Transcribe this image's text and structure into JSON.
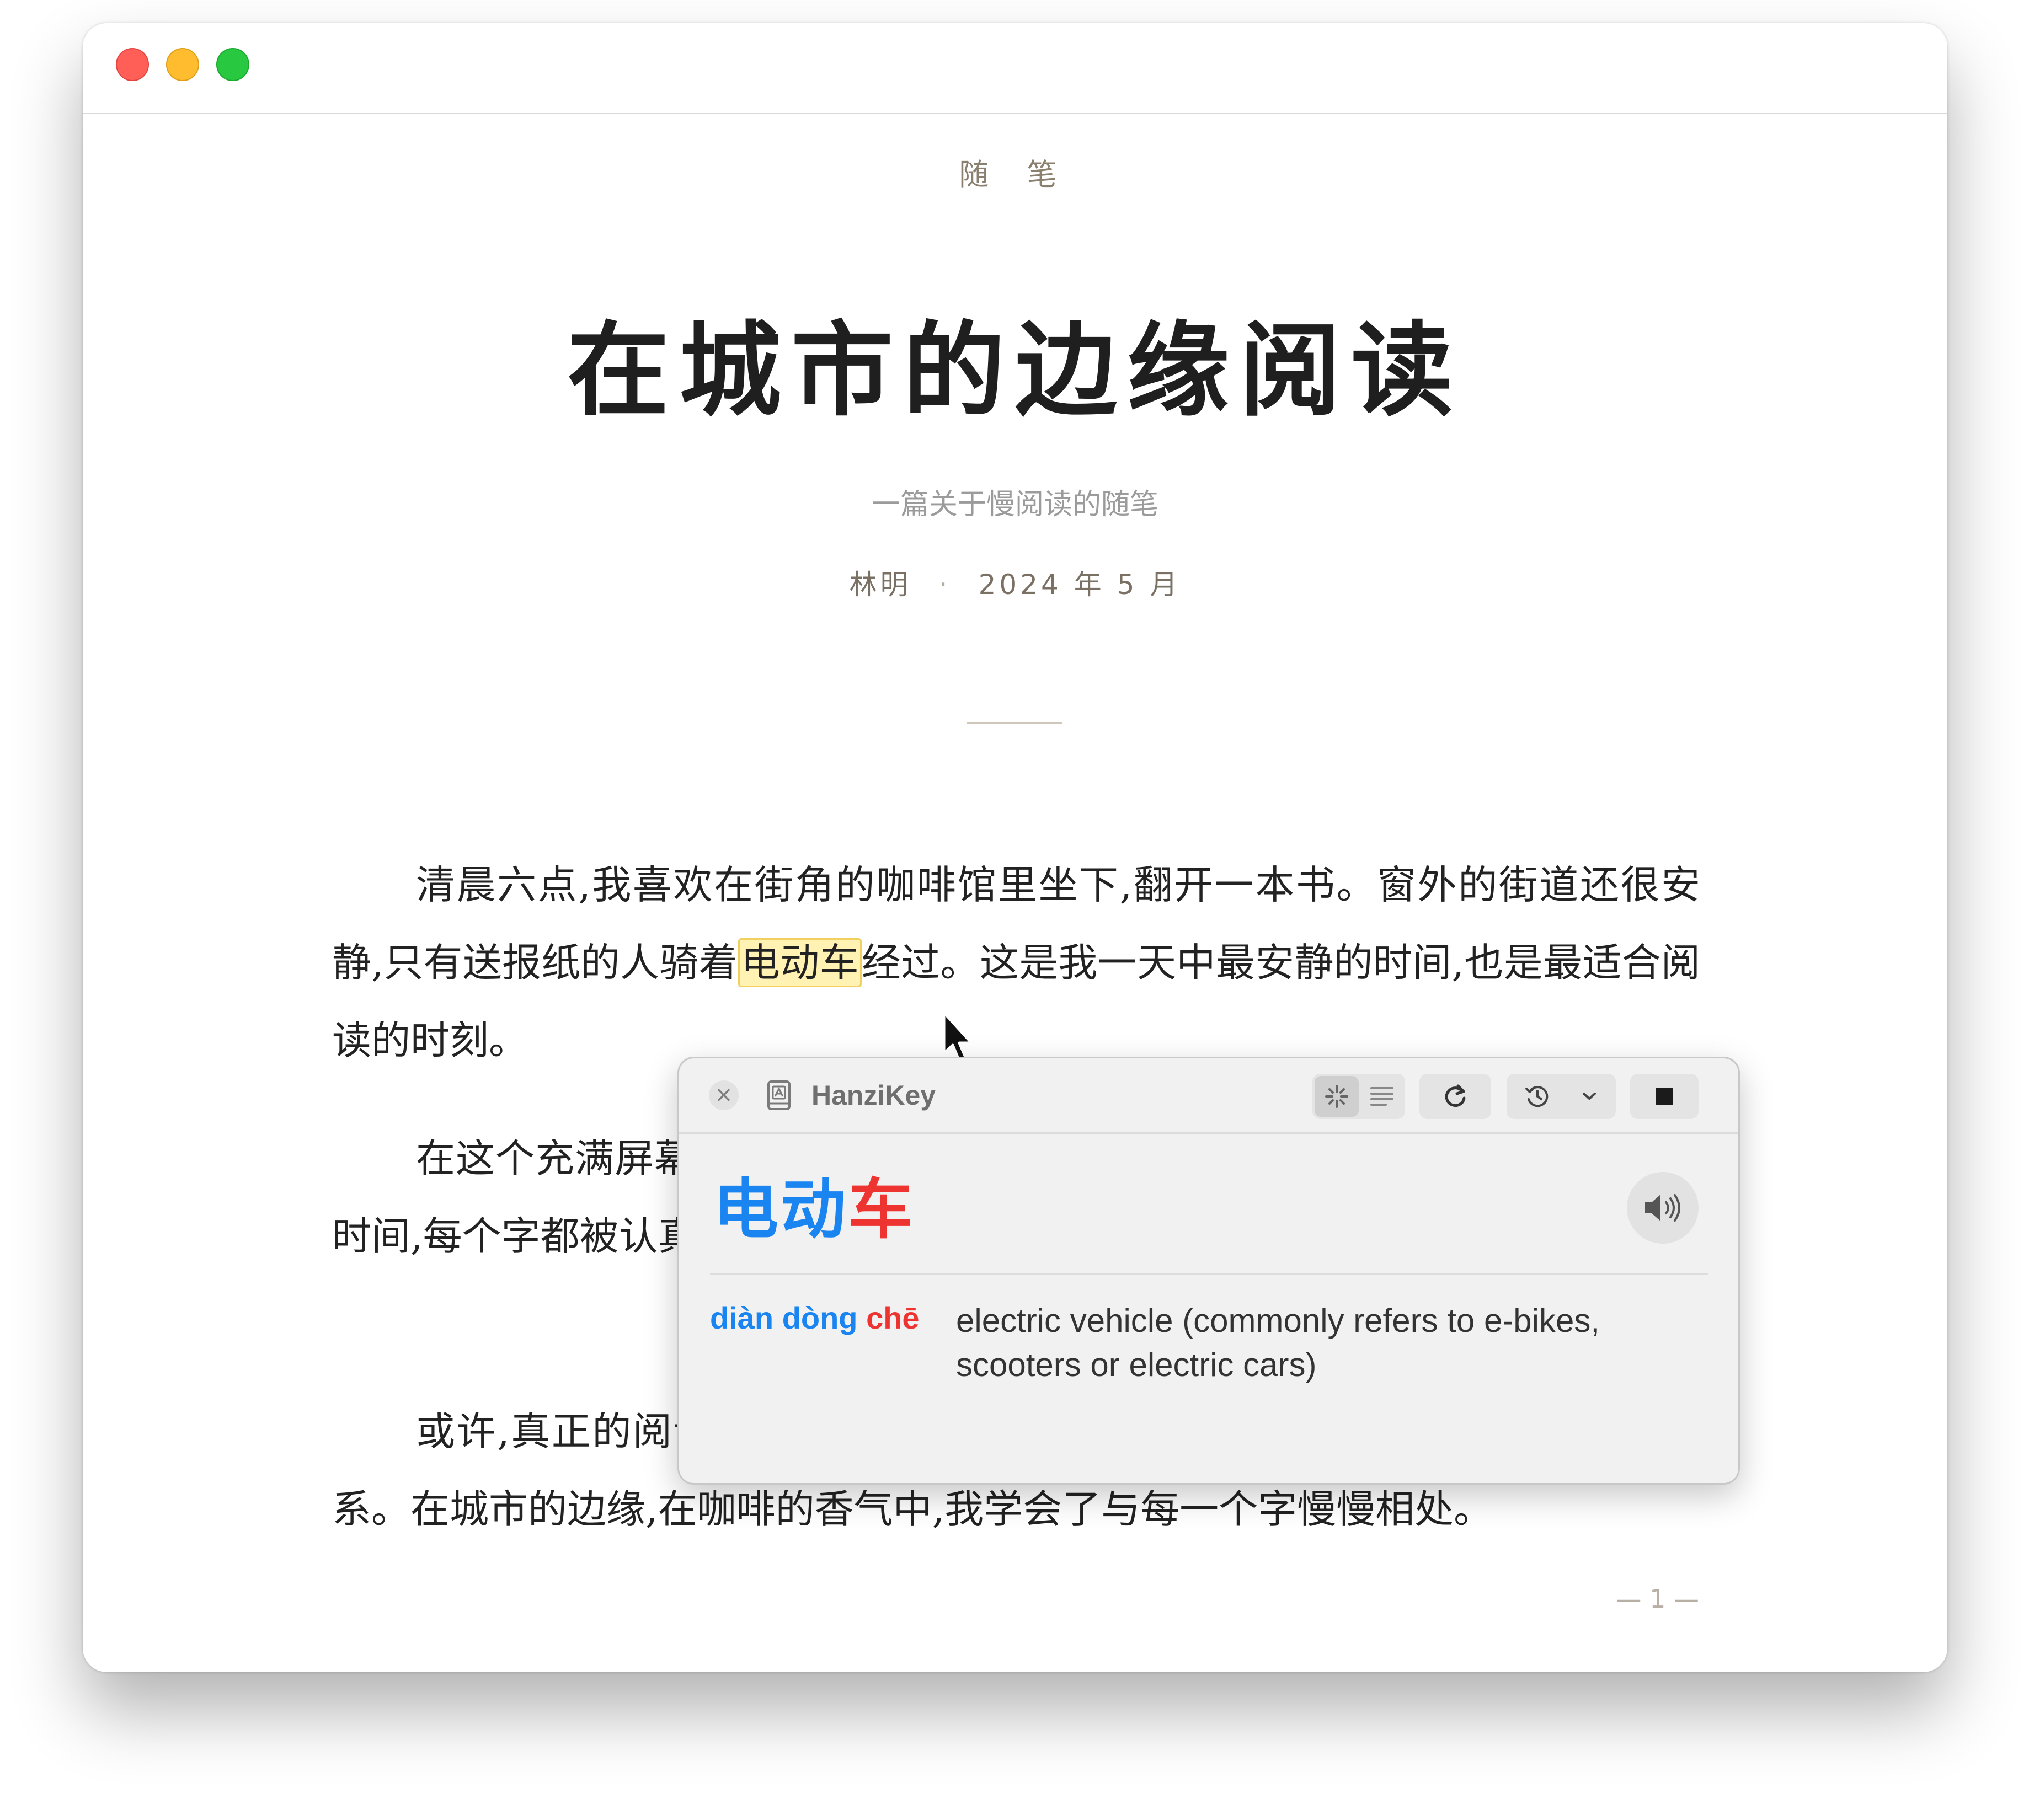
{
  "article": {
    "kicker": "随 笔",
    "title": "在城市的边缘阅读",
    "subtitle": "一篇关于慢阅读的随笔",
    "author": "林明",
    "separator": "·",
    "date": "2024 年 5 月",
    "paragraph1_before": "清晨六点,我喜欢在街角的咖啡馆里坐下,翻开一本书。窗外的街道还很安静,只有送报纸的人骑着",
    "paragraph1_highlight": "电动车",
    "paragraph1_after": "经过。这是我一天中最安静的时间,也是最适合阅读的时刻。",
    "paragraph2": "在这个充满屏幕的时代,纸质书给人一种难得的踏实感。慢慢读一本书需要时间,每个字都被认真地对待。通过这样的阅读,我重新认识了许多熟悉的汉字。",
    "paragraph3": "或许,真正的阅读并不在于读了多少书,而在于与文字建立起一种亲密的关系。在城市的边缘,在咖啡的香气中,我学会了与每一个字慢慢相处。",
    "page_number": "— 1 —"
  },
  "popup": {
    "app_name": "HanziKey",
    "close_symbol": "×",
    "toolbar_icons": [
      "sparkle-icon",
      "list-icon",
      "refresh-icon",
      "history-icon",
      "chevron-down-icon",
      "stop-icon"
    ],
    "word_chars": [
      "电",
      "动",
      "车"
    ],
    "pinyin": [
      "diàn",
      "dòng",
      "chē"
    ],
    "definition": "electric vehicle (commonly refers to e-bikes, scooters or electric cars)",
    "tone_colors": {
      "tone4": "#1a84f0",
      "tone1": "#ee3431"
    }
  }
}
